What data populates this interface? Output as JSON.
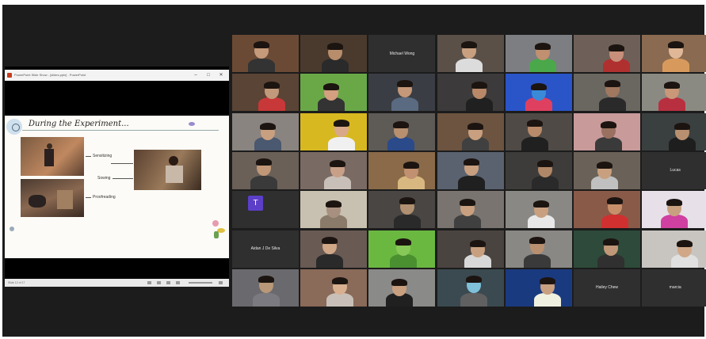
{
  "shared_screen": {
    "title": "PowerPoint Slide Show - [slides.pptx] - PowerPoint",
    "window_buttons": [
      "–",
      "□",
      "✕"
    ],
    "slide": {
      "title": "During the Experiment...",
      "labels": [
        "Sensitizing",
        "Sowing",
        "Proofreading"
      ]
    },
    "status_text": "Slide 12 of 17"
  },
  "participants": [
    {
      "name": "",
      "row": 0,
      "col": 0,
      "bg": "#6b4a35",
      "skin": "#c49a7a",
      "shirt": "#333"
    },
    {
      "name": "",
      "row": 0,
      "col": 1,
      "bg": "#4a3a2d",
      "skin": "#b88d6c",
      "shirt": "#2a2a2a"
    },
    {
      "name": "Michael Wong",
      "row": 0,
      "col": 2,
      "bg": "#2f2f2f",
      "text_only": true
    },
    {
      "name": "",
      "row": 0,
      "col": 3,
      "bg": "#5a5048",
      "skin": "#c8a080",
      "shirt": "#dcdcdc"
    },
    {
      "name": "",
      "row": 0,
      "col": 4,
      "bg": "#7c7e82",
      "skin": "#c09070",
      "shirt": "#4aa84a"
    },
    {
      "name": "",
      "row": 0,
      "col": 5,
      "bg": "#6e6058",
      "skin": "#c8907a",
      "shirt": "#b03030"
    },
    {
      "name": "",
      "row": 0,
      "col": 6,
      "bg": "#8a6a50",
      "skin": "#e0b898",
      "shirt": "#d89a5c"
    },
    {
      "name": "",
      "row": 1,
      "col": 0,
      "bg": "#5a4436",
      "skin": "#c19a7c",
      "shirt": "#c83838"
    },
    {
      "name": "",
      "row": 1,
      "col": 1,
      "bg": "#6aa847",
      "skin": "#d4a080",
      "shirt": "#333"
    },
    {
      "name": "",
      "row": 1,
      "col": 2,
      "bg": "#3a3e44",
      "skin": "#c49878",
      "shirt": "#5a6a80"
    },
    {
      "name": "",
      "row": 1,
      "col": 3,
      "bg": "#3c3a3a",
      "skin": "#b88868",
      "shirt": "#202020"
    },
    {
      "name": "",
      "row": 1,
      "col": 4,
      "bg": "#2a55c8",
      "skin": "#3a8ad8",
      "shirt": "#e04060"
    },
    {
      "name": "",
      "row": 1,
      "col": 5,
      "bg": "#6a6660",
      "skin": "#a07860",
      "shirt": "#2a2a2a"
    },
    {
      "name": "",
      "row": 1,
      "col": 6,
      "bg": "#8a8a82",
      "skin": "#c89878",
      "shirt": "#b83040"
    },
    {
      "name": "",
      "row": 2,
      "col": 0,
      "bg": "#8a8480",
      "skin": "#c8a080",
      "shirt": "#4a5870"
    },
    {
      "name": "",
      "row": 2,
      "col": 1,
      "bg": "#d8b820",
      "skin": "#d8a888",
      "shirt": "#f0f0f0"
    },
    {
      "name": "",
      "row": 2,
      "col": 2,
      "bg": "#5e5a56",
      "skin": "#b89070",
      "shirt": "#2a4a8a"
    },
    {
      "name": "",
      "row": 2,
      "col": 3,
      "bg": "#6c5440",
      "skin": "#c8a080",
      "shirt": "#404040"
    },
    {
      "name": "",
      "row": 2,
      "col": 4,
      "bg": "#504a46",
      "skin": "#b88a6a",
      "shirt": "#202020"
    },
    {
      "name": "",
      "row": 2,
      "col": 5,
      "bg": "#c89a9a",
      "skin": "#9a7060",
      "shirt": "#3a3a3a"
    },
    {
      "name": "",
      "row": 2,
      "col": 6,
      "bg": "#3a4040",
      "skin": "#b89070",
      "shirt": "#1e1e1e"
    },
    {
      "name": "",
      "row": 3,
      "col": 0,
      "bg": "#6a6058",
      "skin": "#c09878",
      "shirt": "#3a3a3a"
    },
    {
      "name": "",
      "row": 3,
      "col": 1,
      "bg": "#7a6a64",
      "skin": "#c8a088",
      "shirt": "#c8c0b8"
    },
    {
      "name": "",
      "row": 3,
      "col": 2,
      "bg": "#8a6a48",
      "skin": "#c09070",
      "shirt": "#d8b880"
    },
    {
      "name": "",
      "row": 3,
      "col": 3,
      "bg": "#5a6270",
      "skin": "#c8a080",
      "shirt": "#202020"
    },
    {
      "name": "",
      "row": 3,
      "col": 4,
      "bg": "#3e3c3a",
      "skin": "#b08868",
      "shirt": "#2a2a2a"
    },
    {
      "name": "",
      "row": 3,
      "col": 5,
      "bg": "#6a6258",
      "skin": "#c8a080",
      "shirt": "#c0c0c0"
    },
    {
      "name": "Lucas",
      "row": 3,
      "col": 6,
      "bg": "#2f2f2f",
      "text_only": true
    },
    {
      "name": "",
      "row": 4,
      "col": 0,
      "bg": "#2f2f2f",
      "avatar": "T"
    },
    {
      "name": "",
      "row": 4,
      "col": 1,
      "bg": "#c8c0b0",
      "skin": "#a89080",
      "shirt": "#8a7a6a"
    },
    {
      "name": "",
      "row": 4,
      "col": 2,
      "bg": "#4a4644",
      "skin": "#b09070",
      "shirt": "#2a2a2a"
    },
    {
      "name": "",
      "row": 4,
      "col": 3,
      "bg": "#7a7470",
      "skin": "#c8a080",
      "shirt": "#404040"
    },
    {
      "name": "",
      "row": 4,
      "col": 4,
      "bg": "#8a8884",
      "skin": "#c8a080",
      "shirt": "#e8e8e8"
    },
    {
      "name": "",
      "row": 4,
      "col": 5,
      "bg": "#8a5a48",
      "skin": "#c8906a",
      "shirt": "#d03030"
    },
    {
      "name": "",
      "row": 4,
      "col": 6,
      "bg": "#e8e0e8",
      "skin": "#c8a080",
      "shirt": "#d040a0"
    },
    {
      "name": "Aidan J De Silva",
      "row": 5,
      "col": 0,
      "bg": "#2f2f2f",
      "text_only": true
    },
    {
      "name": "",
      "row": 5,
      "col": 1,
      "bg": "#6a5a54",
      "skin": "#d0a888",
      "shirt": "#2a2a2a"
    },
    {
      "name": "",
      "row": 5,
      "col": 2,
      "bg": "#6ab840",
      "skin": "#88c858",
      "shirt": "#4a9030"
    },
    {
      "name": "",
      "row": 5,
      "col": 3,
      "bg": "#4a4440",
      "skin": "#c8a080",
      "shirt": "#d8d8d8"
    },
    {
      "name": "",
      "row": 5,
      "col": 4,
      "bg": "#8a8884",
      "skin": "#b89070",
      "shirt": "#3a3a3a"
    },
    {
      "name": "",
      "row": 5,
      "col": 5,
      "bg": "#2e4a3a",
      "skin": "#c09878",
      "shirt": "#303030"
    },
    {
      "name": "",
      "row": 5,
      "col": 6,
      "bg": "#c8c4c0",
      "skin": "#d0a888",
      "shirt": "#e0e0e0"
    },
    {
      "name": "",
      "row": 6,
      "col": 0,
      "bg": "#6a6a6e",
      "skin": "#b89878",
      "shirt": "#7a7a80"
    },
    {
      "name": "",
      "row": 6,
      "col": 1,
      "bg": "#8a6a58",
      "skin": "#d8b090",
      "shirt": "#c8c0b8"
    },
    {
      "name": "",
      "row": 6,
      "col": 2,
      "bg": "#8a8a88",
      "skin": "#c8a080",
      "shirt": "#202020"
    },
    {
      "name": "",
      "row": 6,
      "col": 3,
      "bg": "#3a4a50",
      "skin": "#80c0d8",
      "shirt": "#606060"
    },
    {
      "name": "",
      "row": 6,
      "col": 4,
      "bg": "#1a3a80",
      "skin": "#c8a080",
      "shirt": "#f0f0e0"
    },
    {
      "name": "Hailey Chew",
      "row": 6,
      "col": 5,
      "bg": "#2f2f2f",
      "text_only": true
    },
    {
      "name": "marcia",
      "row": 6,
      "col": 6,
      "bg": "#2f2f2f",
      "text_only": true
    }
  ]
}
